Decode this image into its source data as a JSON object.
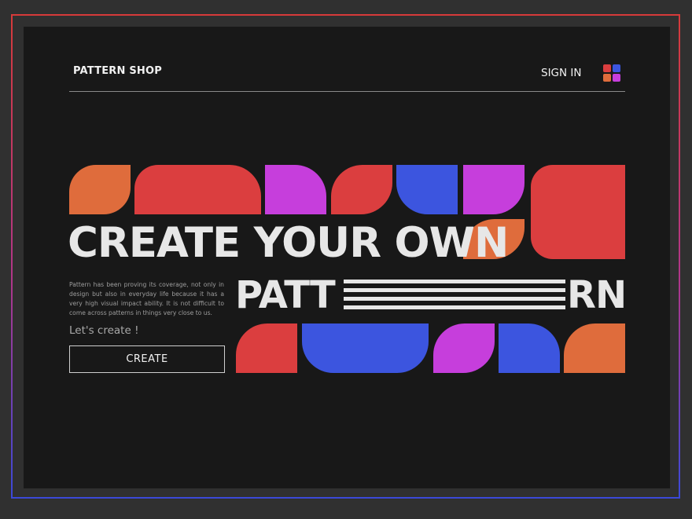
{
  "header": {
    "brand": "PATTERN SHOP",
    "sign_in": "SIGN IN",
    "menu_icon": "grid-icon"
  },
  "hero": {
    "headline": "CREATE YOUR OWN",
    "line2_left": "PATT",
    "line2_right": "RN",
    "description": "Pattern has been proving its coverage, not only in design but also in everyday life because it has a very high visual impact ability. It is not difficult to come across patterns in things very close to us.",
    "cta_text": "Let's create !",
    "create_button": "CREATE"
  },
  "colors": {
    "orange": "#df6c3c",
    "red": "#db3e3f",
    "magenta": "#c63edc",
    "blue": "#3c55df",
    "background": "#181818",
    "text": "#e7e7e7"
  }
}
